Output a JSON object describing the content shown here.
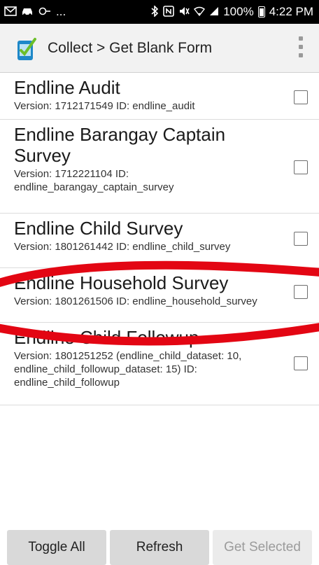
{
  "status": {
    "left_icons": [
      "gmail-icon",
      "car-icon",
      "link-icon",
      "more-notifications"
    ],
    "ellipsis": "...",
    "battery": "100%",
    "time": "4:22 PM"
  },
  "appbar": {
    "title": "Collect > Get Blank Form"
  },
  "forms": [
    {
      "title": "Endline Audit",
      "subtitle": "Version: 1712171549 ID: endline_audit",
      "checked": false
    },
    {
      "title": "Endline Barangay Captain Survey",
      "subtitle": "Version: 1712221104 ID: endline_barangay_captain_survey",
      "checked": false
    },
    {
      "title": "Endline Child Survey",
      "subtitle": "Version: 1801261442 ID: endline_child_survey",
      "checked": false
    },
    {
      "title": "Endline Household Survey",
      "subtitle": "Version: 1801261506 ID: endline_household_survey",
      "checked": false
    },
    {
      "title": "Endline Child Followup",
      "subtitle": "Version: 1801251252 (endline_child_dataset: 10, endline_child_followup_dataset: 15) ID: endline_child_followup",
      "checked": false
    }
  ],
  "buttons": {
    "toggle_all": "Toggle All",
    "refresh": "Refresh",
    "get_selected": "Get Selected"
  },
  "colors": {
    "annotation": "#e30613",
    "statusbar": "#000000",
    "appbar": "#f2f2f2"
  }
}
